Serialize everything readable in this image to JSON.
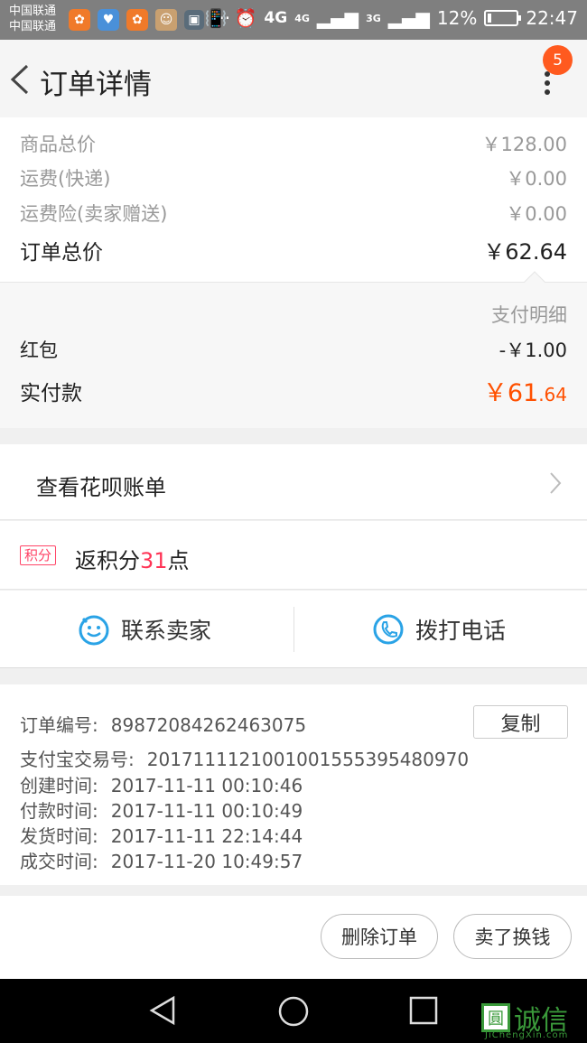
{
  "status_bar": {
    "carrier_1": "中国联通",
    "carrier_2": "中国联通",
    "more": "···",
    "network_1": "4G",
    "network_2": "4G",
    "network_3": "3G",
    "battery_text": "12%",
    "battery_level": 0.12,
    "time": "22:47"
  },
  "header": {
    "title": "订单详情",
    "badge_count": "5"
  },
  "summary": {
    "goods_label": "商品总价",
    "goods_value": "￥128.00",
    "shipping_label": "运费(快递)",
    "shipping_value": "￥0.00",
    "insurance_label": "运费险(卖家赠送)",
    "insurance_value": "￥0.00",
    "total_label": "订单总价",
    "total_value": "￥62.64"
  },
  "payment_detail": {
    "heading": "支付明细",
    "redpacket_label": "红包",
    "redpacket_value": "-￥1.00",
    "actual_label": "实付款",
    "actual_int": "￥61",
    "actual_dec": ".64"
  },
  "huabei": {
    "label": "查看花呗账单"
  },
  "points": {
    "tag": "积分",
    "prefix": "返积分",
    "number": "31",
    "suffix": "点"
  },
  "contact": {
    "seller_label": "联系卖家",
    "phone_label": "拨打电话"
  },
  "order_info": {
    "order_no_label": "订单编号:",
    "order_no_value": "89872084262463075",
    "copy_label": "复制",
    "alipay_label": "支付宝交易号:",
    "alipay_value": "2017111121001001555395480970",
    "created_label": "创建时间:",
    "created_value": "2017-11-11 00:10:46",
    "paid_label": "付款时间:",
    "paid_value": "2017-11-11 00:10:49",
    "shipped_label": "发货时间:",
    "shipped_value": "2017-11-11 22:14:44",
    "closed_label": "成交时间:",
    "closed_value": "2017-11-20 10:49:57"
  },
  "actions": {
    "delete_label": "删除订单",
    "sell_label": "卖了换钱"
  },
  "watermark": {
    "logo_char": "圓",
    "text": "诚信",
    "url": "JiChengXin.com"
  },
  "colors": {
    "accent_orange": "#ff5000",
    "points_red": "#ff3355",
    "icon_blue": "#2aa3e6",
    "badge": "#ff5a1f"
  }
}
